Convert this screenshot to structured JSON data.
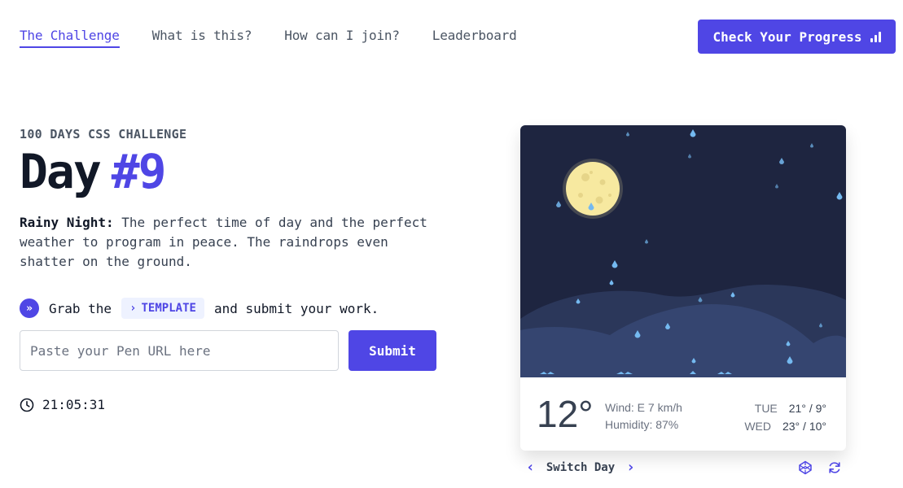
{
  "nav": {
    "links": [
      {
        "label": "The Challenge",
        "active": true
      },
      {
        "label": "What is this?",
        "active": false
      },
      {
        "label": "How can I join?",
        "active": false
      },
      {
        "label": "Leaderboard",
        "active": false
      }
    ],
    "progress_button": "Check Your Progress",
    "progress_icon": "bar-chart-icon"
  },
  "hero": {
    "eyebrow": "100 DAYS CSS CHALLENGE",
    "title_prefix": "Day",
    "title_number": "#9",
    "desc_bold": "Rainy Night:",
    "desc_text": " The perfect time of day and the perfect weather to program in peace. The raindrops even shatter on the ground."
  },
  "submit": {
    "grab_text": "Grab the",
    "template_label": "TEMPLATE",
    "after_text": "and submit your work.",
    "input_placeholder": "Paste your Pen URL here",
    "input_value": "",
    "button_label": "Submit"
  },
  "timer": {
    "value": "21:05:31"
  },
  "card": {
    "temperature": "12°",
    "wind": "Wind: E 7 km/h",
    "humidity": "Humidity: 87%",
    "forecast": [
      {
        "day": "TUE",
        "range": "21° / 9°"
      },
      {
        "day": "WED",
        "range": "23° / 10°"
      }
    ],
    "colors": {
      "sky": "#1e2540",
      "hill_back": "#2d3a5c",
      "hill_front": "#37476e",
      "moon": "#f7e9a0",
      "rain": "#74b9f0"
    }
  },
  "switcher": {
    "label": "Switch Day"
  },
  "accent": "#4f46e5"
}
